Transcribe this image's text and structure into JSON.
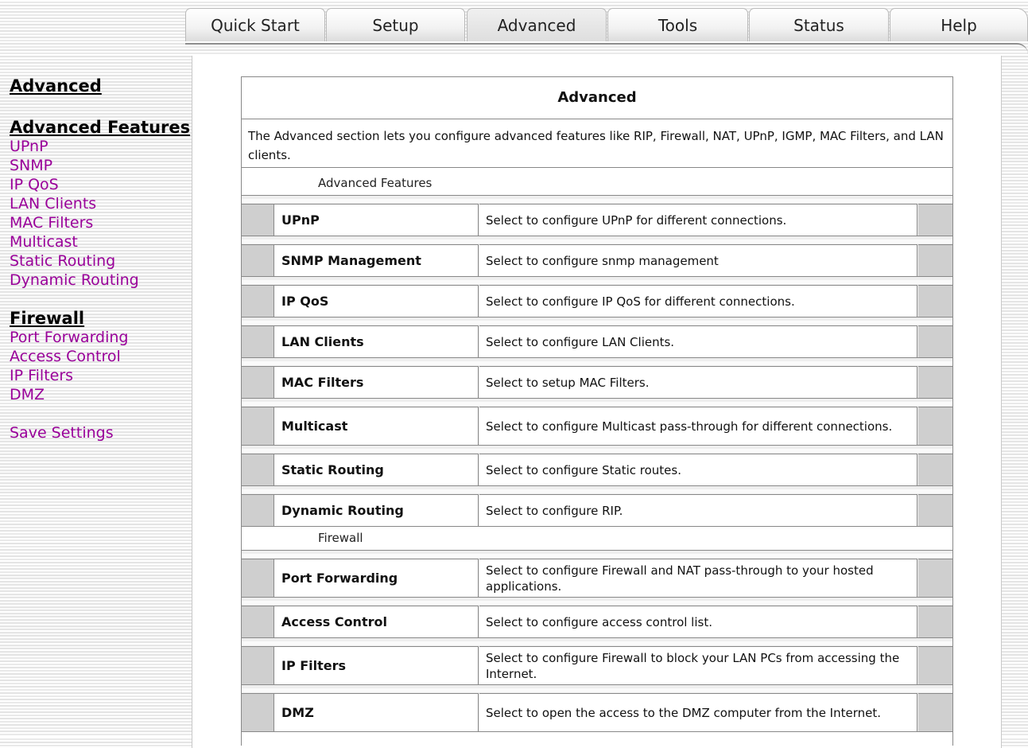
{
  "tabs": [
    {
      "label": "Quick Start"
    },
    {
      "label": "Setup"
    },
    {
      "label": "Advanced"
    },
    {
      "label": "Tools"
    },
    {
      "label": "Status"
    },
    {
      "label": "Help"
    }
  ],
  "sidebar": {
    "title": "Advanced",
    "features_heading": "Advanced Features",
    "features": [
      "UPnP",
      "SNMP",
      "IP QoS",
      "LAN Clients",
      "MAC Filters",
      "Multicast",
      "Static Routing",
      "Dynamic Routing"
    ],
    "firewall_heading": "Firewall",
    "firewall": [
      "Port Forwarding",
      "Access Control",
      "IP Filters",
      "DMZ"
    ],
    "save": "Save Settings"
  },
  "main": {
    "title": "Advanced",
    "description": "The Advanced section lets you configure advanced features like RIP, Firewall, NAT, UPnP, IGMP, MAC Filters, and LAN clients.",
    "group1_label": "Advanced Features",
    "group1_rows": [
      {
        "name": "UPnP",
        "desc": "Select to configure UPnP for different connections."
      },
      {
        "name": "SNMP Management",
        "desc": "Select to configure snmp management"
      },
      {
        "name": "IP QoS",
        "desc": "Select to configure IP QoS for different connections."
      },
      {
        "name": "LAN Clients",
        "desc": "Select to configure LAN Clients."
      },
      {
        "name": "MAC Filters",
        "desc": "Select to setup MAC Filters."
      },
      {
        "name": "Multicast",
        "desc": "Select to configure Multicast pass-through for different connections."
      },
      {
        "name": "Static Routing",
        "desc": "Select to configure Static routes."
      },
      {
        "name": "Dynamic Routing",
        "desc": "Select to configure RIP."
      }
    ],
    "group2_label": "Firewall",
    "group2_rows": [
      {
        "name": "Port Forwarding",
        "desc": "Select to configure Firewall and NAT pass-through to your hosted applications."
      },
      {
        "name": "Access Control",
        "desc": "Select to configure access control list."
      },
      {
        "name": "IP Filters",
        "desc": "Select to configure Firewall to block your LAN PCs from accessing the Internet."
      },
      {
        "name": "DMZ",
        "desc": "Select to open the access to the DMZ computer from the Internet."
      }
    ]
  }
}
